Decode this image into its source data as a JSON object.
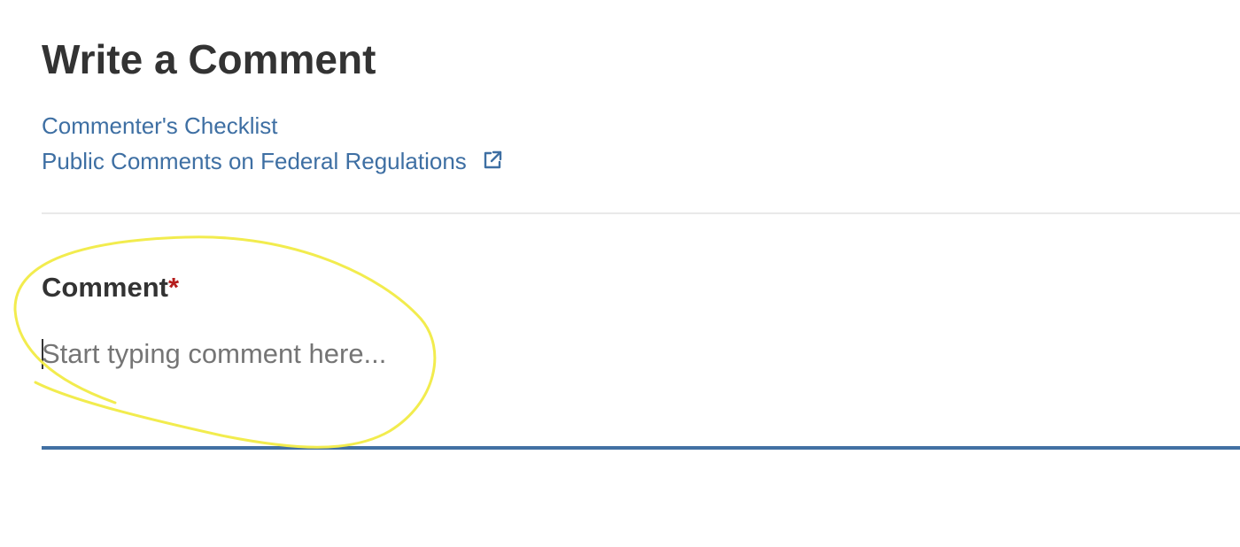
{
  "page": {
    "title": "Write a Comment"
  },
  "links": {
    "checklist_label": "Commenter's Checklist",
    "public_comments_label": "Public Comments on Federal Regulations",
    "external_icon": "external-link-icon"
  },
  "form": {
    "comment_label": "Comment",
    "required_marker": "*",
    "comment_value": "",
    "comment_placeholder": "Start typing comment here..."
  },
  "colors": {
    "link": "#3e6fa3",
    "required": "#b51d1d",
    "textarea_underline": "#4270a3",
    "annotation": "#f2ec4e"
  }
}
